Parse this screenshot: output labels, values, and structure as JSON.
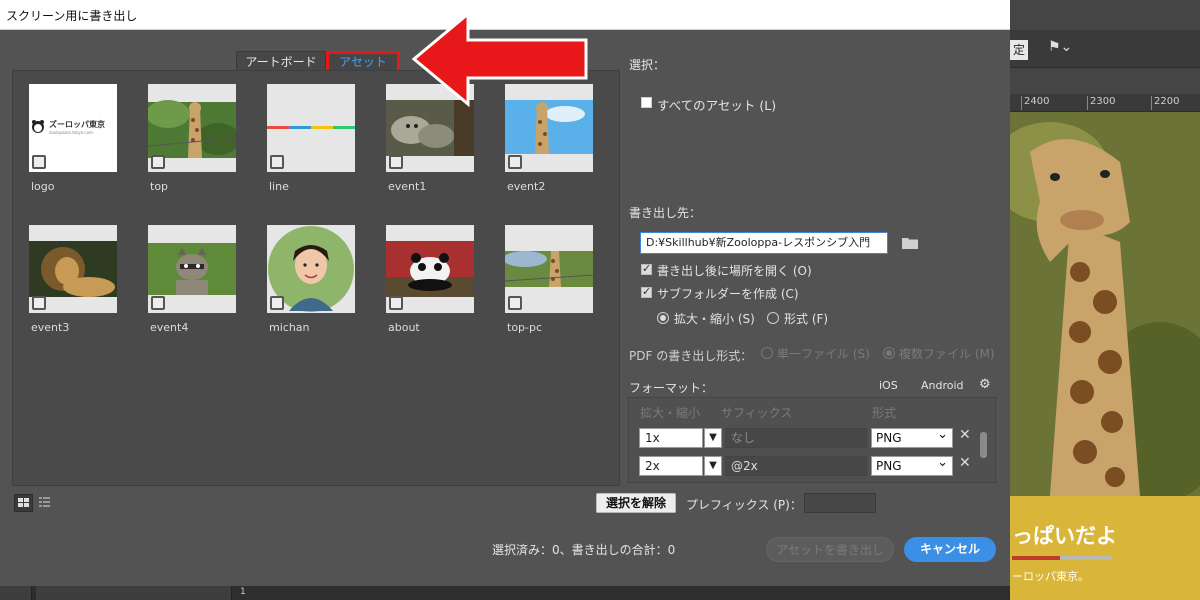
{
  "dialog": {
    "title": "スクリーン用に書き出し",
    "tabs": {
      "artboard": "アートボード",
      "asset": "アセット"
    },
    "assets": [
      {
        "label": "logo",
        "checked": false,
        "logo_text": "ズーロッパ東京",
        "logo_sub": "zoolopaoro.tokyo.com"
      },
      {
        "label": "top",
        "checked": false
      },
      {
        "label": "line",
        "checked": false
      },
      {
        "label": "event1",
        "checked": false
      },
      {
        "label": "event2",
        "checked": false
      },
      {
        "label": "event3",
        "checked": false
      },
      {
        "label": "event4",
        "checked": false
      },
      {
        "label": "michan",
        "checked": false
      },
      {
        "label": "about",
        "checked": false
      },
      {
        "label": "top-pc",
        "checked": false
      }
    ],
    "right": {
      "select_label": "選択：",
      "all_assets": "すべてのアセット (L)",
      "destination_label": "書き出し先：",
      "destination_path": "D:¥Skillhub¥新Zooloppa-レスポンシブ入門",
      "open_after": "書き出し後に場所を開く (O)",
      "subfolder": "サブフォルダーを作成 (C)",
      "scale_option": "拡大・縮小 (S)",
      "format_option": "形式 (F)",
      "pdf_label": "PDF の書き出し形式：",
      "pdf_single": "単一ファイル (S)",
      "pdf_multi": "複数ファイル (M)",
      "format_label": "フォーマット：",
      "ios": "iOS",
      "android": "Android",
      "col_scale": "拡大・縮小",
      "col_suffix": "サフィックス",
      "col_format": "形式",
      "rows": [
        {
          "scale": "1x",
          "suffix": "",
          "suffix_placeholder": "なし",
          "format": "PNG"
        },
        {
          "scale": "2x",
          "suffix": "@2x",
          "suffix_placeholder": "",
          "format": "PNG"
        }
      ],
      "deselect": "選択を解除",
      "prefix_label": "プレフィックス (P)：",
      "status": "選択済み：0、書き出しの合計：0",
      "export_button": "アセットを書き出し",
      "cancel_button": "キャンセル"
    }
  },
  "background_app": {
    "toolbar_button_fragment": "定",
    "ruler_ticks": [
      "2400",
      "2300",
      "2200"
    ],
    "banner_text": "っぱいだよ",
    "banner_sub": "ーロッパ東京。",
    "bottom_number": "1"
  },
  "colors": {
    "accent": "#3b8fe5",
    "highlight": "#e8181a",
    "active_tab_text": "#3fa3ff"
  }
}
